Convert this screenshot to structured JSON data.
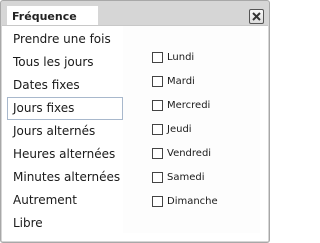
{
  "tab": {
    "label": "Fréquence"
  },
  "close": {
    "icon": "close-icon"
  },
  "menu": {
    "items": [
      "Prendre une fois",
      "Tous les jours",
      "Dates fixes",
      "Jours fixes",
      "Jours alternés",
      "Heures alternées",
      "Minutes alternées",
      "Autrement",
      "Libre"
    ],
    "selected": "Jours fixes"
  },
  "days": [
    "Lundi",
    "Mardi",
    "Mercredi",
    "Jeudi",
    "Vendredi",
    "Samedi",
    "Dimanche"
  ],
  "colors": {
    "frame": "#d6d6d6",
    "selected_border": "#a8b8cc"
  }
}
